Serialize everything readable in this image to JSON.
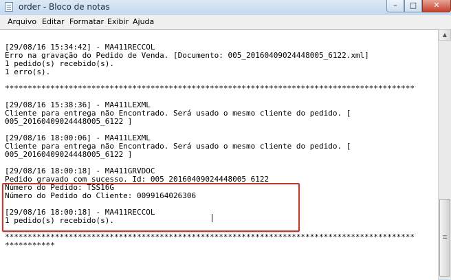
{
  "window": {
    "title": "order - Bloco de notas",
    "minimize_glyph": "–",
    "maximize_glyph": "□",
    "close_glyph": "✕"
  },
  "menu": [
    "Arquivo",
    "Editar",
    "Formatar",
    "Exibir",
    "Ajuda"
  ],
  "editor": {
    "lines": [
      "[29/08/16 15:34:42] - MA411RECCOL",
      "Erro na gravação do Pedido de Venda. [Documento: 005_20160409024448005_6122.xml]",
      "1 pedido(s) recebido(s).",
      "1 erro(s).",
      "",
      "******************************************************************************************",
      "",
      "[29/08/16 15:38:36] - MA411LEXML",
      "Cliente para entrega não Encontrado. Será usado o mesmo cliente do pedido. [",
      "005_20160409024448005_6122 ]",
      "",
      "[29/08/16 18:00:06] - MA411LEXML",
      "Cliente para entrega não Encontrado. Será usado o mesmo cliente do pedido. [",
      "005_20160409024448005_6122 ]",
      "",
      "[29/08/16 18:00:18] - MA411GRVDOC",
      "Pedido gravado com sucesso. Id: 005_20160409024448005_6122",
      "Número do Pedido: TSS16G",
      "Número do Pedido do Cliente: 0099164026306",
      "",
      "[29/08/16 18:00:18] - MA411RECCOL",
      "1 pedido(s) recebido(s).",
      "",
      "******************************************************************************************",
      "***********"
    ]
  },
  "scroll_up_glyph": "▲",
  "colors": {
    "highlight_border": "#c0392b",
    "titlebar": "#c9dcef",
    "close_button": "#c6402c"
  }
}
